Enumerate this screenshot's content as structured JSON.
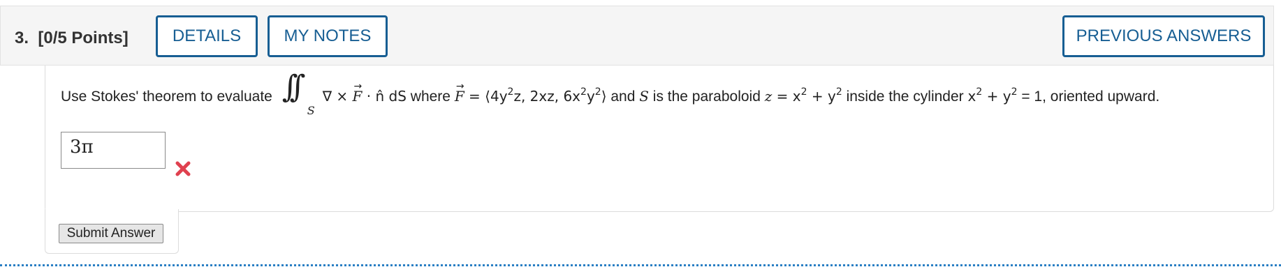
{
  "question": {
    "number": "3.",
    "points": "[0/5 Points]",
    "buttons": {
      "details": "DETAILS",
      "my_notes": "MY NOTES",
      "previous_answers": "PREVIOUS ANSWERS"
    },
    "prompt": {
      "lead": "Use Stokes' theorem to evaluate",
      "integral_sub": "S",
      "curl": "∇ × ",
      "F": "F",
      "dot_n_dS": " · n̂ dS",
      "where": " where ",
      "field_eq": " = ⟨4y",
      "field_z": "z, 2xz, 6x",
      "field_y": "y",
      "field_end": "⟩",
      "and_S": " and ",
      "S": "S",
      "surface": " is the paraboloid ",
      "z": "z",
      "eq_x": " = x",
      "plus_y": " + y",
      "inside": " inside the cylinder ",
      "cyl_x": "x",
      "cyl_plus_y": " + y",
      "cyl_end": " = 1, oriented upward.",
      "exp": "2"
    },
    "answer_value": "3π",
    "status_icon": "incorrect-x-icon",
    "submit_label": "Submit Answer"
  },
  "colors": {
    "accent": "#175e93",
    "incorrect": "#e0414f",
    "dotted_divider": "#2a7fc4"
  }
}
